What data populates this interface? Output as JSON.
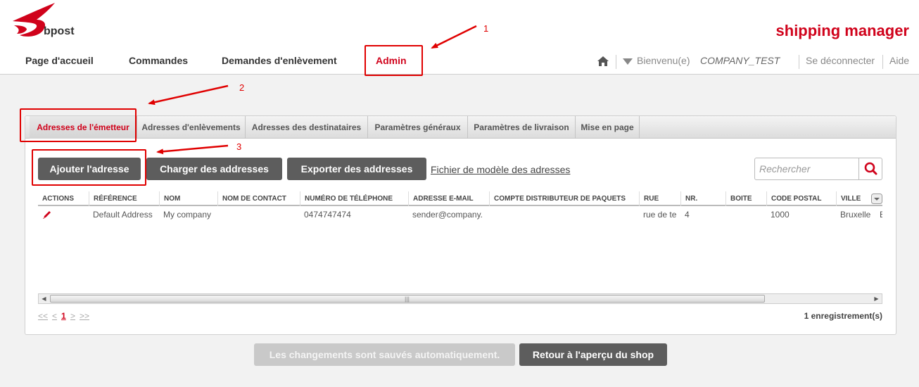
{
  "brand": {
    "logo_text": "bpost",
    "app_title": "shipping manager",
    "accent": "#d0021b"
  },
  "nav": {
    "items": [
      {
        "label": "Page d'accueil"
      },
      {
        "label": "Commandes"
      },
      {
        "label": "Demandes d'enlèvement"
      },
      {
        "label": "Admin"
      }
    ],
    "active": "Admin"
  },
  "topbar": {
    "welcome": "Bienvenu(e)",
    "company": "COMPANY_TEST",
    "logout": "Se déconnecter",
    "help": "Aide"
  },
  "annotations": {
    "n1": "1",
    "n2": "2",
    "n3": "3",
    "color": "#e00000"
  },
  "tabs": [
    {
      "label": "Adresses de l'émetteur"
    },
    {
      "label": "Adresses d'enlèvements"
    },
    {
      "label": "Adresses des destinataires"
    },
    {
      "label": "Paramètres généraux"
    },
    {
      "label": "Paramètres de livraison"
    },
    {
      "label": "Mise en page"
    }
  ],
  "toolbar": {
    "add": "Ajouter l'adresse",
    "upload": "Charger des addresses",
    "export": "Exporter des addresses",
    "template_link": "Fichier de modèle des adresses",
    "search_placeholder": "Rechercher"
  },
  "table": {
    "columns": [
      "ACTIONS",
      "RÉFÉRENCE",
      "NOM",
      "NOM DE CONTACT",
      "NUMÉRO DE TÉLÉPHONE",
      "ADRESSE E-MAIL",
      "COMPTE DISTRIBUTEUR DE PAQUETS",
      "RUE",
      "NR.",
      "BOITE",
      "CODE POSTAL",
      "VILLE"
    ],
    "rows": [
      {
        "reference": "Default Address",
        "name": "My company",
        "contact": "",
        "phone": "0474747474",
        "email": "sender@company.",
        "distributor": "",
        "street": "rue de te",
        "nr": "4",
        "box": "",
        "postal": "1000",
        "city": "Bruxelle",
        "extra": "B"
      }
    ]
  },
  "pager": {
    "first": "<<",
    "prev": "<",
    "page": "1",
    "next": ">",
    "last": ">>",
    "count": "1 enregistrement(s)"
  },
  "footer": {
    "autosave": "Les changements sont sauvés automatiquement.",
    "back": "Retour à l'aperçu du shop"
  }
}
